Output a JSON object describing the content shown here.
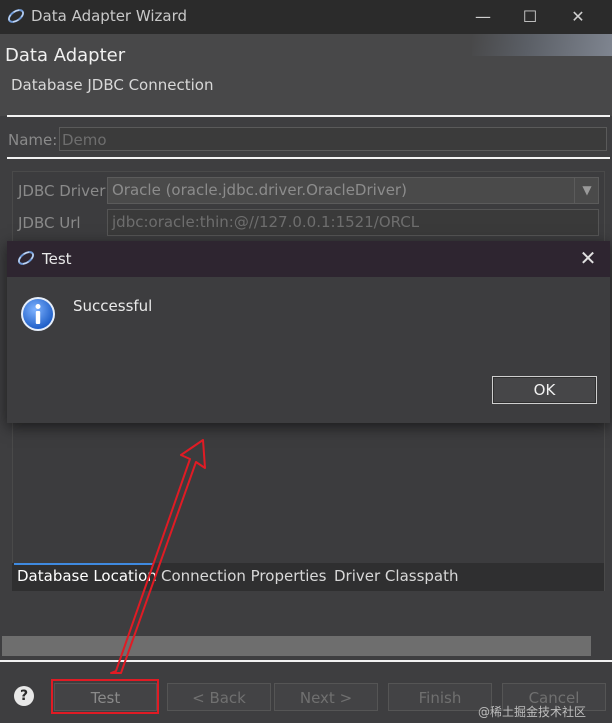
{
  "window": {
    "title": "Data Adapter Wizard",
    "app_icon": "eclipse-icon",
    "minimize_glyph": "—",
    "maximize_glyph": "☐",
    "close_glyph": "✕"
  },
  "wizard": {
    "title": "Data Adapter",
    "subtitle": "Database JDBC Connection"
  },
  "name_field": {
    "label": "Name:",
    "value": "Demo"
  },
  "jdbc": {
    "driver_label": "JDBC Driver",
    "driver_value": "Oracle (oracle.jdbc.driver.OracleDriver)",
    "url_label": "JDBC Url",
    "url_value": "jdbc:oracle:thin:@//127.0.0.1:1521/ORCL"
  },
  "tabs": [
    {
      "label": "Database Location",
      "selected": true
    },
    {
      "label": "Connection Properties",
      "selected": false
    },
    {
      "label": "Driver Classpath",
      "selected": false
    }
  ],
  "buttons": {
    "help_glyph": "?",
    "test": "Test",
    "back": "< Back",
    "next": "Next >",
    "finish": "Finish",
    "cancel": "Cancel"
  },
  "dialog": {
    "title": "Test",
    "message": "Successful",
    "ok": "OK",
    "close_glyph": "✕",
    "icon": "info-icon"
  },
  "watermark": "@稀土掘金技术社区",
  "colors": {
    "annotation_red": "#e01b24",
    "info_blue": "#1f5fc8",
    "tab_indicator": "#3f8ae0"
  }
}
